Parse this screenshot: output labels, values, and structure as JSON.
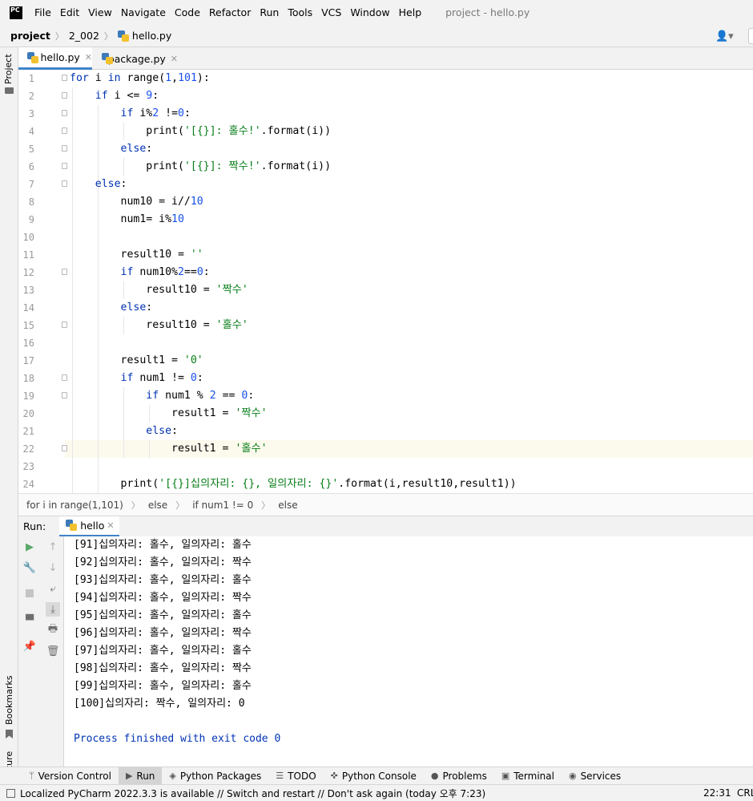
{
  "menubar": {
    "logo": "PC",
    "items": [
      "File",
      "Edit",
      "View",
      "Navigate",
      "Code",
      "Refactor",
      "Run",
      "Tools",
      "VCS",
      "Window",
      "Help"
    ],
    "title": "project - hello.py"
  },
  "navbar": {
    "crumbs": [
      "project",
      "2_002",
      "hello.py"
    ]
  },
  "left_strip": {
    "project": "Project",
    "bookmarks": "Bookmarks",
    "structure": "Structure"
  },
  "tabs": [
    {
      "label": "hello.py",
      "active": true
    },
    {
      "label": "package.py",
      "active": false
    }
  ],
  "editor": {
    "line_numbers": [
      "1",
      "2",
      "3",
      "4",
      "5",
      "6",
      "7",
      "8",
      "9",
      "10",
      "11",
      "12",
      "13",
      "14",
      "15",
      "16",
      "17",
      "18",
      "19",
      "20",
      "21",
      "22",
      "23",
      "24"
    ],
    "current_line": 22
  },
  "code_breadcrumbs": [
    "for i in range(1,101)",
    "else",
    "if num1 != 0",
    "else"
  ],
  "run_window": {
    "title": "Run:",
    "tab": "hello",
    "output": [
      "[91]십의자리: 홀수, 일의자리: 홀수",
      "[92]십의자리: 홀수, 일의자리: 짝수",
      "[93]십의자리: 홀수, 일의자리: 홀수",
      "[94]십의자리: 홀수, 일의자리: 짝수",
      "[95]십의자리: 홀수, 일의자리: 홀수",
      "[96]십의자리: 홀수, 일의자리: 짝수",
      "[97]십의자리: 홀수, 일의자리: 홀수",
      "[98]십의자리: 홀수, 일의자리: 짝수",
      "[99]십의자리: 홀수, 일의자리: 홀수",
      "[100]십의자리: 짝수, 일의자리: 0",
      "",
      "Process finished with exit code 0"
    ]
  },
  "bottombar": [
    "Version Control",
    "Run",
    "Python Packages",
    "TODO",
    "Python Console",
    "Problems",
    "Terminal",
    "Services"
  ],
  "statusbar": {
    "message": "Localized PyCharm 2022.3.3 is available // Switch and restart // Don't ask again (today 오후 7:23)",
    "position": "22:31",
    "line_sep": "CRLF"
  }
}
